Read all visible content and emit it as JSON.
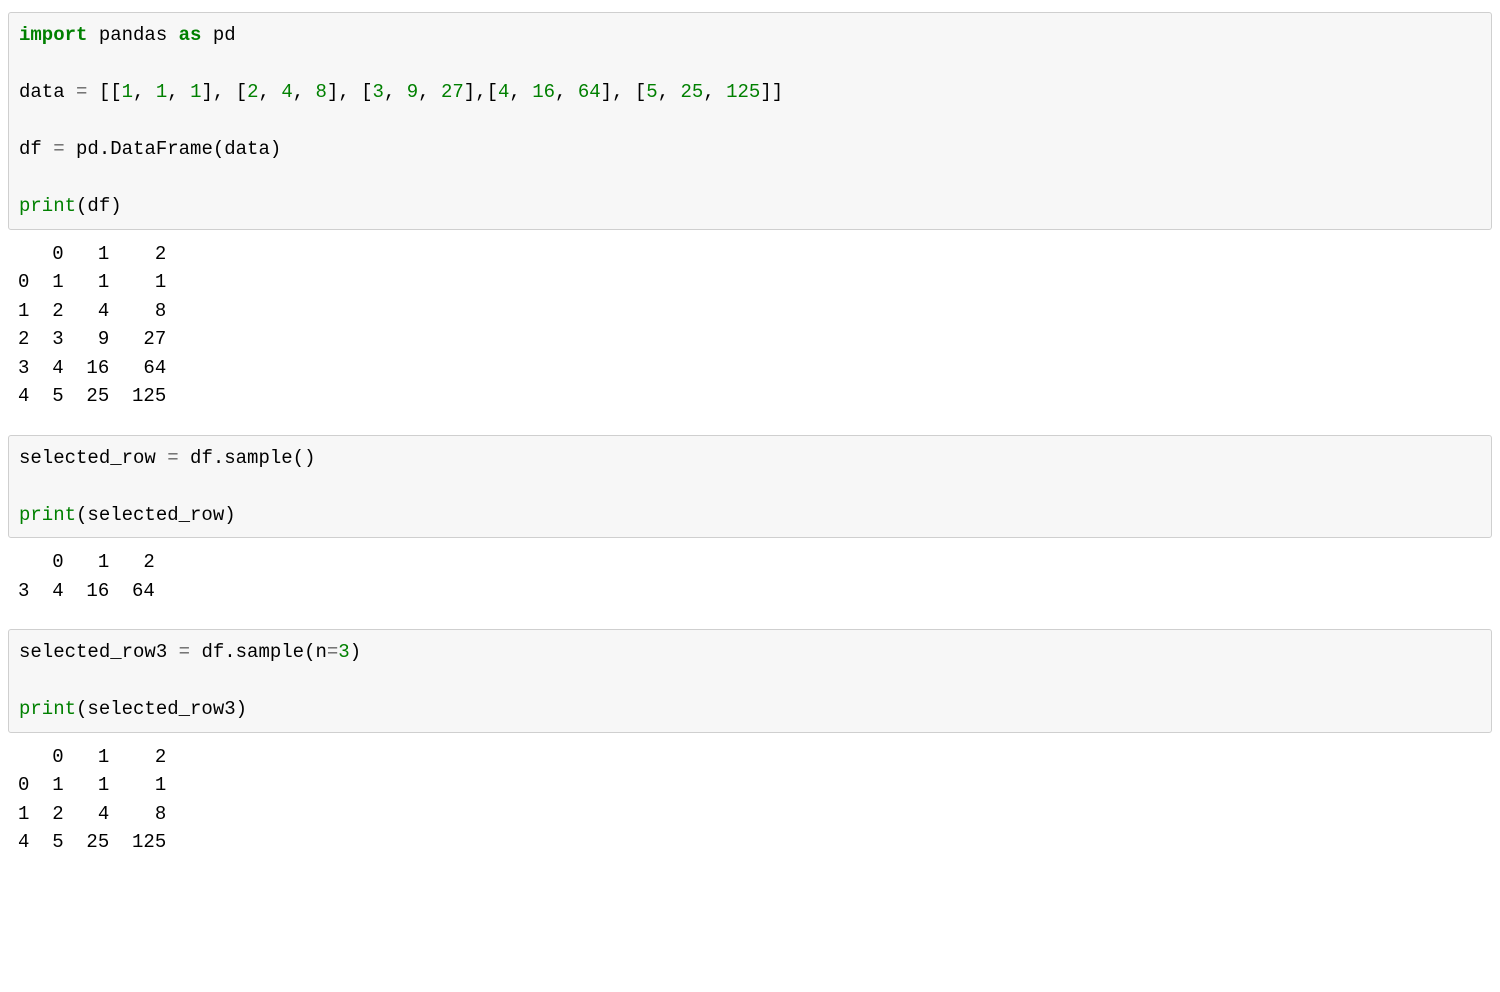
{
  "cell1": {
    "kw_import": "import",
    "pandas": "pandas",
    "kw_as": "as",
    "pd": "pd",
    "data_name": "data",
    "eq": "=",
    "lb": "[[",
    "n1": "1",
    "c": ",",
    "sp": " ",
    "arr_text_open": "[[",
    "row1_a": "1",
    "row1_b": "1",
    "row1_c": "1",
    "row2_a": "2",
    "row2_b": "4",
    "row2_c": "8",
    "row3_a": "3",
    "row3_b": "9",
    "row3_c": "27",
    "row4_a": "4",
    "row4_b": "16",
    "row4_c": "64",
    "row5_a": "5",
    "row5_b": "25",
    "row5_c": "125",
    "df_name": "df",
    "pd_DataFrame": "pd.DataFrame(data)",
    "print": "print",
    "df_arg": "(df)"
  },
  "out1": "   0   1    2\n0  1   1    1\n1  2   4    8\n2  3   9   27\n3  4  16   64\n4  5  25  125",
  "cell2": {
    "lhs": "selected_row",
    "eq": "=",
    "rhs": "df.sample()",
    "print": "print",
    "arg": "(selected_row)"
  },
  "out2": "   0   1   2\n3  4  16  64",
  "cell3": {
    "lhs": "selected_row3",
    "eq": "=",
    "rhs_pre": "df.sample(n",
    "rhs_eq": "=",
    "rhs_num": "3",
    "rhs_post": ")",
    "print": "print",
    "arg": "(selected_row3)"
  },
  "out3": "   0   1    2\n0  1   1    1\n1  2   4    8\n4  5  25  125",
  "punct": {
    "comma": ",",
    "space": " ",
    "ob": "[",
    "cb": "]",
    "obb": "[[",
    "cbb": "]]"
  }
}
